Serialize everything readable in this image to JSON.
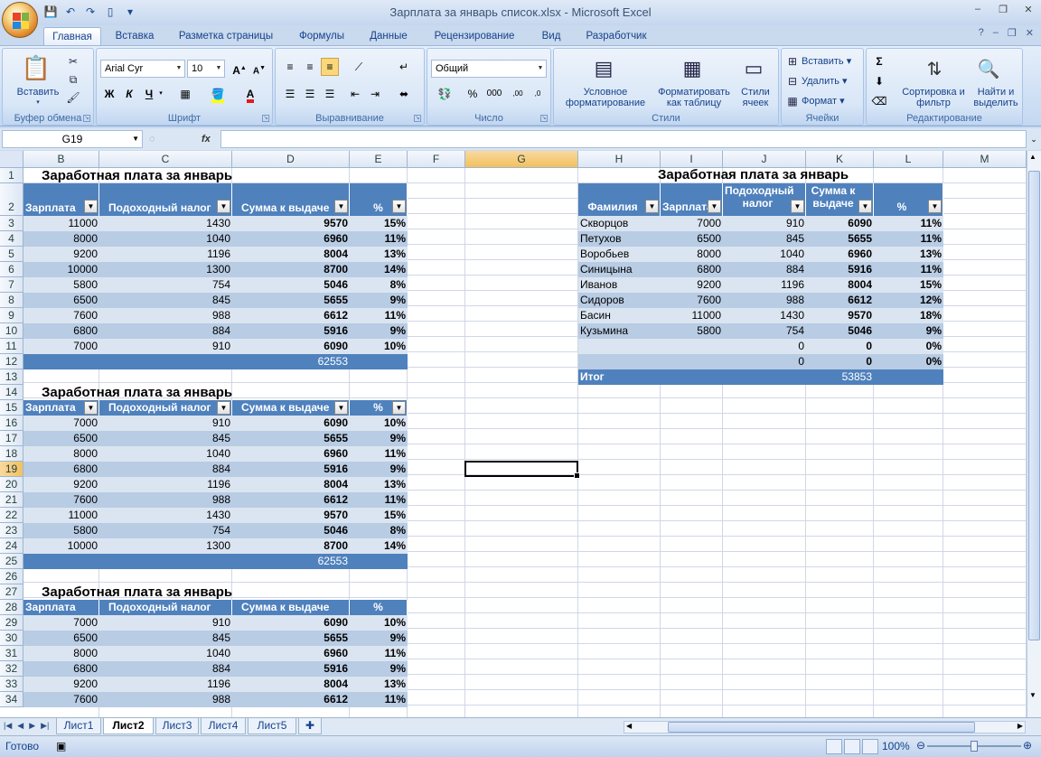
{
  "window": {
    "title": "Зарплата за январь список.xlsx - Microsoft Excel",
    "controls": [
      "minimize-icon",
      "restore-icon",
      "close-icon"
    ]
  },
  "ribbon_tabs": [
    "Главная",
    "Вставка",
    "Разметка страницы",
    "Формулы",
    "Данные",
    "Рецензирование",
    "Вид",
    "Разработчик"
  ],
  "ribbon": {
    "clipboard": {
      "label": "Буфер обмена",
      "paste": "Вставить"
    },
    "font": {
      "label": "Шрифт",
      "name": "Arial Cyr",
      "size": "10",
      "bold": "Ж",
      "italic": "К",
      "underline": "Ч",
      "font_color": "A"
    },
    "alignment": {
      "label": "Выравнивание"
    },
    "number": {
      "label": "Число",
      "format": "Общий",
      "percent": "%",
      "thousands": "000"
    },
    "styles": {
      "label": "Стили",
      "conditional": "Условное форматирование",
      "format_table": "Форматировать как таблицу",
      "cell_styles": "Стили ячеек"
    },
    "cells": {
      "label": "Ячейки",
      "insert": "Вставить",
      "delete": "Удалить",
      "format": "Формат"
    },
    "editing": {
      "label": "Редактирование",
      "sum": "Σ",
      "sort": "Сортировка и фильтр",
      "find": "Найти и выделить"
    }
  },
  "formula_bar": {
    "name_box": "G19",
    "fx": "fx",
    "formula": ""
  },
  "columns": [
    "B",
    "C",
    "D",
    "E",
    "F",
    "G",
    "H",
    "I",
    "J",
    "K",
    "L",
    "M"
  ],
  "selected_column": "G",
  "rows": [
    "1",
    "2",
    "3",
    "4",
    "5",
    "6",
    "7",
    "8",
    "9",
    "10",
    "11",
    "12",
    "13",
    "14",
    "15",
    "16",
    "17",
    "18",
    "19",
    "20",
    "21",
    "22",
    "23",
    "24",
    "25",
    "26",
    "27",
    "28",
    "29",
    "30",
    "31",
    "32",
    "33",
    "34"
  ],
  "selected_row": "19",
  "table1": {
    "title": "Заработная плата за январь",
    "headers": [
      "Зарплата",
      "Подоходный налог",
      "Сумма к выдаче",
      "%"
    ],
    "rows": [
      [
        "11000",
        "1430",
        "9570",
        "15%"
      ],
      [
        "8000",
        "1040",
        "6960",
        "11%"
      ],
      [
        "9200",
        "1196",
        "8004",
        "13%"
      ],
      [
        "10000",
        "1300",
        "8700",
        "14%"
      ],
      [
        "5800",
        "754",
        "5046",
        "8%"
      ],
      [
        "6500",
        "845",
        "5655",
        "9%"
      ],
      [
        "7600",
        "988",
        "6612",
        "11%"
      ],
      [
        "6800",
        "884",
        "5916",
        "9%"
      ],
      [
        "7000",
        "910",
        "6090",
        "10%"
      ]
    ],
    "total": "62553"
  },
  "table2": {
    "title": "Заработная плата за январь",
    "headers": [
      "Зарплата",
      "Подоходный налог",
      "Сумма к выдаче",
      "%"
    ],
    "rows": [
      [
        "7000",
        "910",
        "6090",
        "10%"
      ],
      [
        "6500",
        "845",
        "5655",
        "9%"
      ],
      [
        "8000",
        "1040",
        "6960",
        "11%"
      ],
      [
        "6800",
        "884",
        "5916",
        "9%"
      ],
      [
        "9200",
        "1196",
        "8004",
        "13%"
      ],
      [
        "7600",
        "988",
        "6612",
        "11%"
      ],
      [
        "11000",
        "1430",
        "9570",
        "15%"
      ],
      [
        "5800",
        "754",
        "5046",
        "8%"
      ],
      [
        "10000",
        "1300",
        "8700",
        "14%"
      ]
    ],
    "total": "62553"
  },
  "table3": {
    "title": "Заработная плата за январь",
    "headers": [
      "Зарплата",
      "Подоходный налог",
      "Сумма к выдаче",
      "%"
    ],
    "rows": [
      [
        "7000",
        "910",
        "6090",
        "10%"
      ],
      [
        "6500",
        "845",
        "5655",
        "9%"
      ],
      [
        "8000",
        "1040",
        "6960",
        "11%"
      ],
      [
        "6800",
        "884",
        "5916",
        "9%"
      ],
      [
        "9200",
        "1196",
        "8004",
        "13%"
      ],
      [
        "7600",
        "988",
        "6612",
        "11%"
      ]
    ]
  },
  "table4": {
    "title": "Заработная плата за январь",
    "headers": [
      "Фамилия",
      "Зарплата",
      "Подоходный налог",
      "Сумма к выдаче",
      "%"
    ],
    "rows": [
      [
        "Скворцов",
        "7000",
        "910",
        "6090",
        "11%"
      ],
      [
        "Петухов",
        "6500",
        "845",
        "5655",
        "11%"
      ],
      [
        "Воробьев",
        "8000",
        "1040",
        "6960",
        "13%"
      ],
      [
        "Синицына",
        "6800",
        "884",
        "5916",
        "11%"
      ],
      [
        "Иванов",
        "9200",
        "1196",
        "8004",
        "15%"
      ],
      [
        "Сидоров",
        "7600",
        "988",
        "6612",
        "12%"
      ],
      [
        "Басин",
        "11000",
        "1430",
        "9570",
        "18%"
      ],
      [
        "Кузьмина",
        "5800",
        "754",
        "5046",
        "9%"
      ],
      [
        "",
        "",
        "0",
        "0",
        "0%"
      ],
      [
        "",
        "",
        "0",
        "0",
        "0%"
      ]
    ],
    "total_label": "Итог",
    "total": "53853"
  },
  "sheet_tabs": [
    "Лист1",
    "Лист2",
    "Лист3",
    "Лист4",
    "Лист5"
  ],
  "active_sheet": "Лист2",
  "status": {
    "ready": "Готово",
    "zoom": "100%"
  },
  "colors": {
    "table_header": "#4f81bd",
    "band_light": "#dbe5f1",
    "band_dark": "#b8cce4"
  }
}
